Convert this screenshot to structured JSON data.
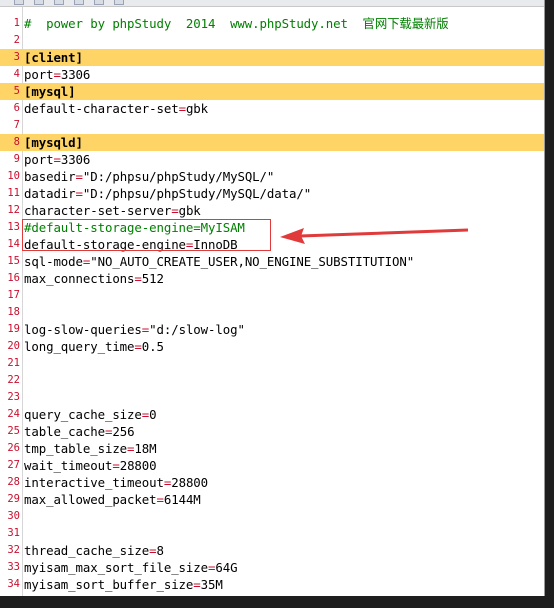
{
  "editor": {
    "lines": [
      {
        "n": "1",
        "type": "comment",
        "text": "#  power by phpStudy  2014  www.phpStudy.net  官网下载最新版"
      },
      {
        "n": "2",
        "type": "blank"
      },
      {
        "n": "3",
        "type": "section",
        "text": "[client]"
      },
      {
        "n": "4",
        "type": "kv",
        "key": "port",
        "value": "3306"
      },
      {
        "n": "5",
        "type": "section",
        "text": "[mysql]"
      },
      {
        "n": "6",
        "type": "kv",
        "key": "default-character-set",
        "value": "gbk"
      },
      {
        "n": "7",
        "type": "blank"
      },
      {
        "n": "8",
        "type": "section",
        "text": "[mysqld]"
      },
      {
        "n": "9",
        "type": "kv",
        "key": "port",
        "value": "3306"
      },
      {
        "n": "10",
        "type": "kv",
        "key": "basedir",
        "value": "\"D:/phpsu/phpStudy/MySQL/\""
      },
      {
        "n": "11",
        "type": "kv",
        "key": "datadir",
        "value": "\"D:/phpsu/phpStudy/MySQL/data/\""
      },
      {
        "n": "12",
        "type": "kv",
        "key": "character-set-server",
        "value": "gbk"
      },
      {
        "n": "13",
        "type": "comment",
        "text": "#default-storage-engine=MyISAM"
      },
      {
        "n": "14",
        "type": "kv",
        "key": "default-storage-engine",
        "value": "InnoDB"
      },
      {
        "n": "15",
        "type": "kv",
        "key": "sql-mode",
        "value": "\"NO_AUTO_CREATE_USER,NO_ENGINE_SUBSTITUTION\""
      },
      {
        "n": "16",
        "type": "kv",
        "key": "max_connections",
        "value": "512"
      },
      {
        "n": "17",
        "type": "blank"
      },
      {
        "n": "18",
        "type": "blank"
      },
      {
        "n": "19",
        "type": "kv",
        "key": "log-slow-queries",
        "value": "\"d:/slow-log\""
      },
      {
        "n": "20",
        "type": "kv",
        "key": "long_query_time",
        "value": "0.5"
      },
      {
        "n": "21",
        "type": "blank"
      },
      {
        "n": "22",
        "type": "blank"
      },
      {
        "n": "23",
        "type": "blank"
      },
      {
        "n": "24",
        "type": "kv",
        "key": "query_cache_size",
        "value": "0"
      },
      {
        "n": "25",
        "type": "kv",
        "key": "table_cache",
        "value": "256"
      },
      {
        "n": "26",
        "type": "kv",
        "key": "tmp_table_size",
        "value": "18M"
      },
      {
        "n": "27",
        "type": "kv",
        "key": "wait_timeout",
        "value": "28800"
      },
      {
        "n": "28",
        "type": "kv",
        "key": "interactive_timeout",
        "value": "28800"
      },
      {
        "n": "29",
        "type": "kv",
        "key": "max_allowed_packet",
        "value": "6144M"
      },
      {
        "n": "30",
        "type": "blank"
      },
      {
        "n": "31",
        "type": "blank"
      },
      {
        "n": "32",
        "type": "kv",
        "key": "thread_cache_size",
        "value": "8"
      },
      {
        "n": "33",
        "type": "kv",
        "key": "myisam_max_sort_file_size",
        "value": "64G"
      },
      {
        "n": "34",
        "type": "kv",
        "key": "myisam_sort_buffer_size",
        "value": "35M"
      }
    ]
  },
  "colors": {
    "line_number": "#c8102e",
    "section_highlight": "#ffd466",
    "comment": "#008000",
    "operator": "#c8102e",
    "annotation": "#e03a3a"
  },
  "icons": {
    "toolbar": [
      "file-icon",
      "save-icon",
      "cut-icon",
      "copy-icon",
      "paste-icon",
      "undo-icon"
    ],
    "annotation": "red-arrow-icon"
  }
}
